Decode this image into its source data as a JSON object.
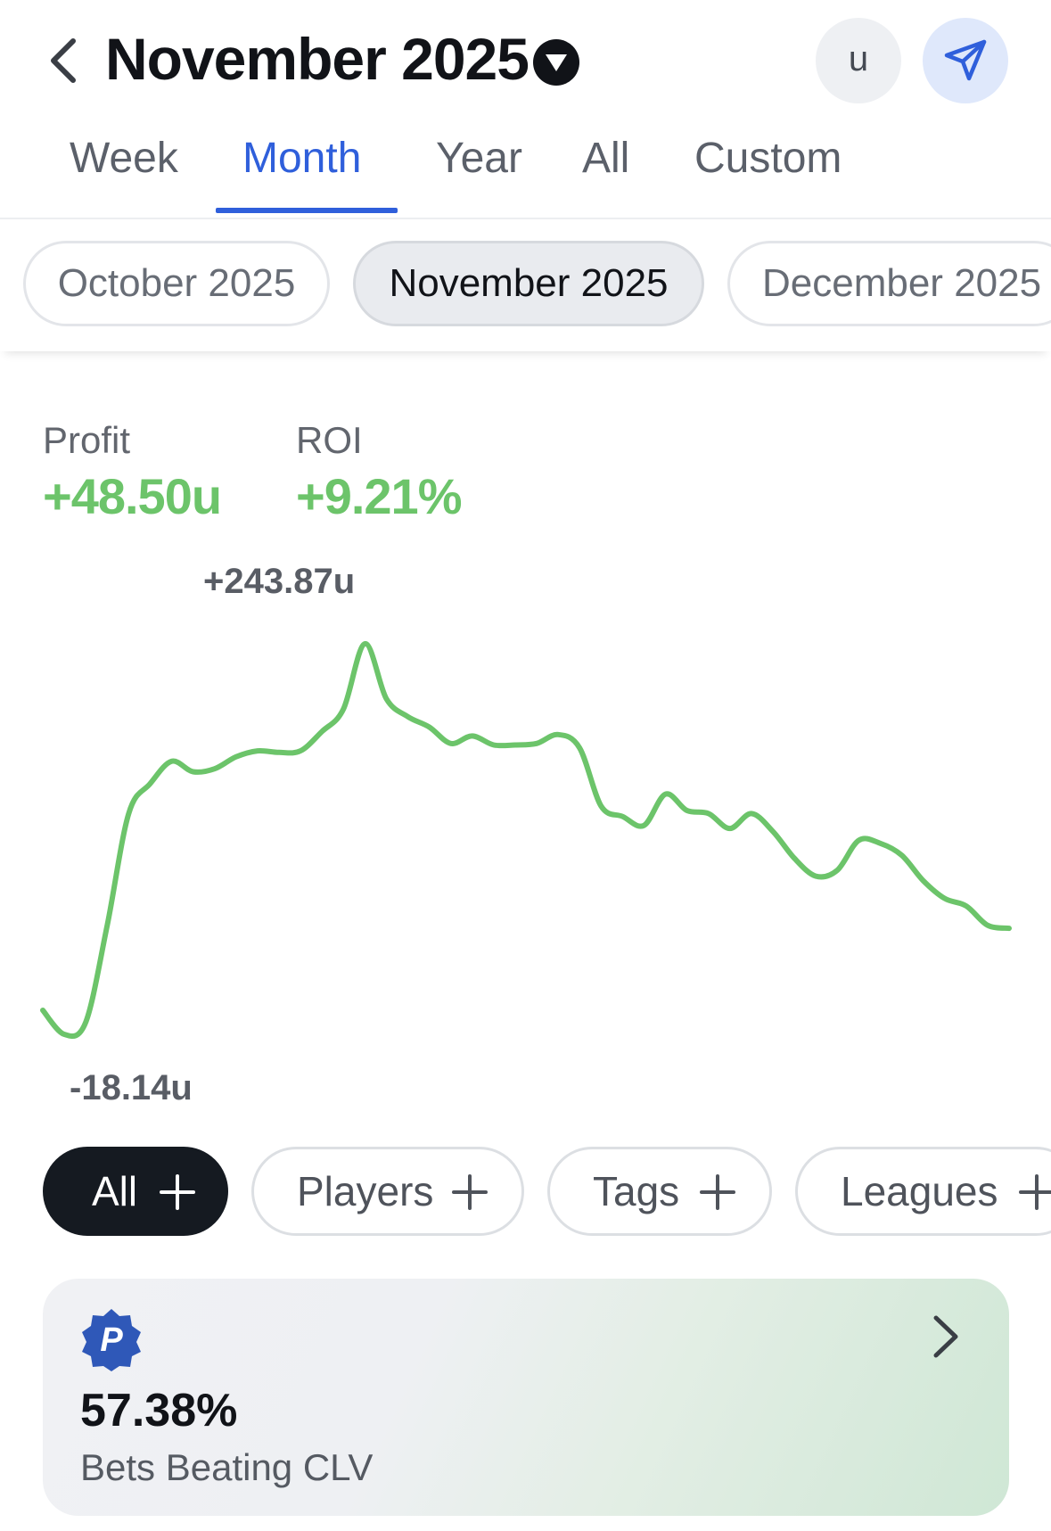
{
  "header": {
    "title": "November 2025",
    "unit_label": "u"
  },
  "tabs": [
    {
      "label": "Week",
      "active": false
    },
    {
      "label": "Month",
      "active": true
    },
    {
      "label": "Year",
      "active": false
    },
    {
      "label": "All",
      "active": false
    },
    {
      "label": "Custom",
      "active": false
    }
  ],
  "months": [
    {
      "label": "October 2025",
      "selected": false
    },
    {
      "label": "November 2025",
      "selected": true
    },
    {
      "label": "December 2025",
      "selected": false
    }
  ],
  "stats": {
    "profit_label": "Profit",
    "profit_value": "+48.50u",
    "roi_label": "ROI",
    "roi_value": "+9.21%"
  },
  "chart_data": {
    "type": "line",
    "title": "",
    "xlabel": "",
    "ylabel": "",
    "max_label": "+243.87u",
    "min_label": "-18.14u",
    "ylim": [
      -18.14,
      243.87
    ],
    "grid": false,
    "series": [
      {
        "color": "#6cc46a",
        "values": [
          -2,
          -18.14,
          -10,
          55,
          130,
          150,
          165,
          158,
          160,
          168,
          172,
          171,
          172,
          185,
          200,
          243.87,
          207,
          195,
          188,
          177,
          182,
          176,
          176,
          177,
          183,
          174,
          135,
          128,
          122,
          143,
          132,
          130,
          120,
          130,
          118,
          100,
          88,
          92,
          112,
          110,
          102,
          85,
          73,
          68,
          55,
          53
        ]
      }
    ]
  },
  "filters": [
    {
      "label": "All",
      "active": true
    },
    {
      "label": "Players",
      "active": false
    },
    {
      "label": "Tags",
      "active": false
    },
    {
      "label": "Leagues",
      "active": false
    }
  ],
  "clv_card": {
    "logo_letter": "P",
    "value": "57.38%",
    "label": "Bets Beating CLV",
    "logo_color": "#2f58b8"
  },
  "colors": {
    "accent": "#2f5fdb",
    "positive": "#6cc46a",
    "dark": "#151a21"
  }
}
